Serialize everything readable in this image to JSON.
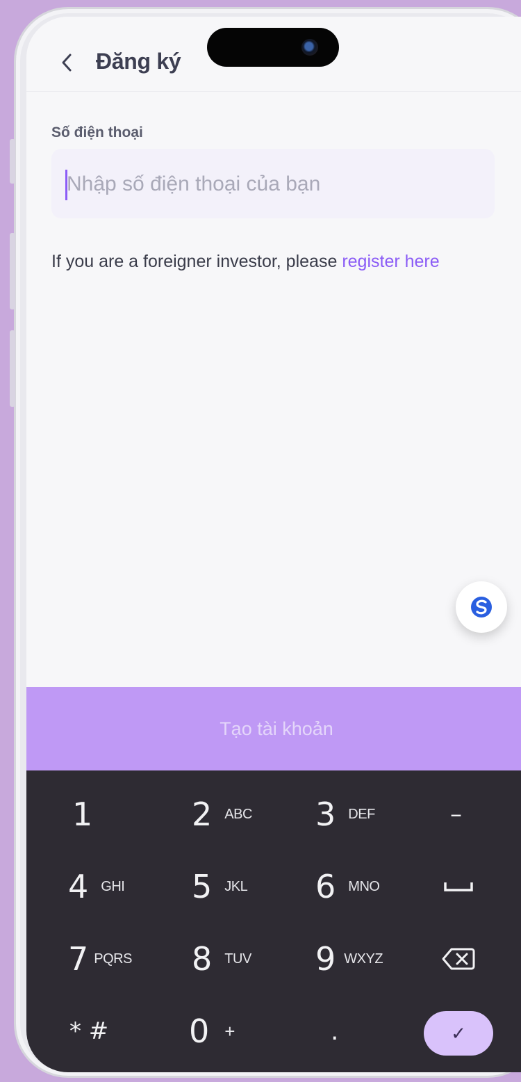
{
  "header": {
    "title": "Đăng ký"
  },
  "form": {
    "phone_label": "Số điện thoại",
    "phone_placeholder": "Nhập số điện thoại của bạn",
    "phone_value": ""
  },
  "foreigner": {
    "prefix": "If you are a foreigner investor, please ",
    "link": "register here"
  },
  "cta": {
    "label": "Tạo tài khoản"
  },
  "keyboard": {
    "rows": [
      [
        {
          "n": "1",
          "s": ""
        },
        {
          "n": "2",
          "s": "ABC"
        },
        {
          "n": "3",
          "s": "DEF"
        },
        {
          "n": "–",
          "s": ""
        }
      ],
      [
        {
          "n": "4",
          "s": "GHI"
        },
        {
          "n": "5",
          "s": "JKL"
        },
        {
          "n": "6",
          "s": "MNO"
        },
        {
          "n": "␣",
          "s": ""
        }
      ],
      [
        {
          "n": "7",
          "s": "PQRS"
        },
        {
          "n": "8",
          "s": "TUV"
        },
        {
          "n": "9",
          "s": "WXYZ"
        },
        {
          "n": "⌫",
          "s": ""
        }
      ],
      [
        {
          "n": "* #",
          "s": ""
        },
        {
          "n": "0",
          "s": "+"
        },
        {
          "n": ".",
          "s": ""
        },
        {
          "n": "✓",
          "s": ""
        }
      ]
    ]
  },
  "colors": {
    "accent": "#8b5cf6",
    "cta_bg": "#bf99f5",
    "keyboard_bg": "#2e2b33"
  }
}
